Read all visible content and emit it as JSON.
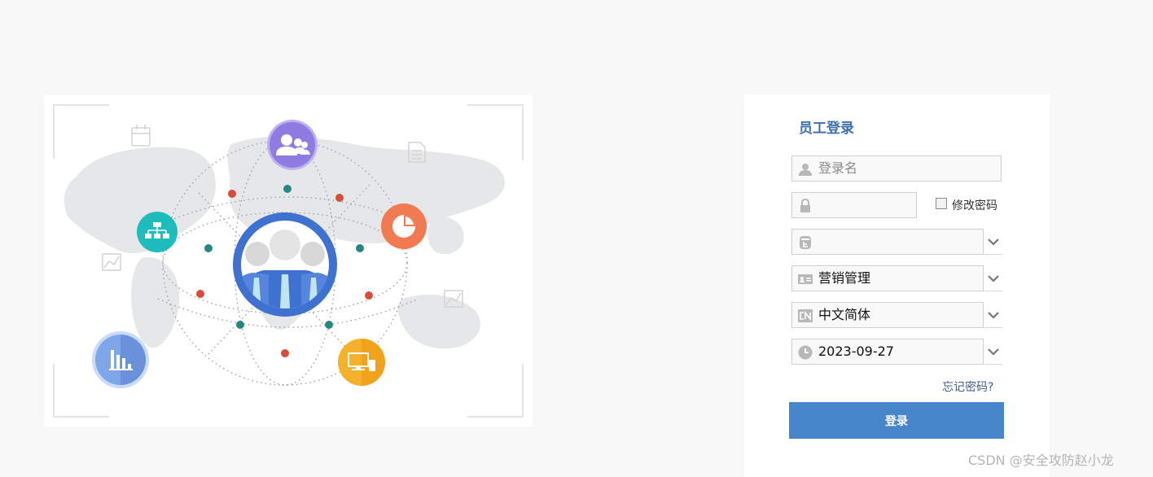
{
  "login": {
    "title": "员工登录",
    "username_placeholder": "登录名",
    "password_value": "",
    "change_password_label": "修改密码",
    "account_set_value": "",
    "module_value": "营销管理",
    "language_value": "中文简体",
    "date_value": "2023-09-27",
    "forgot_password": "忘记密码?",
    "submit_label": "登录"
  },
  "watermark": "CSDN @安全攻防赵小龙",
  "icons": {
    "illustration": [
      "people-icon",
      "sitemap-icon",
      "pie-chart-icon",
      "bar-chart-icon",
      "devices-icon",
      "user-group-icon",
      "calendar-icon",
      "document-icon",
      "line-chart-icon"
    ],
    "form": [
      "user-icon",
      "lock-icon",
      "database-icon",
      "id-card-icon",
      "cn-language-icon",
      "clock-icon",
      "chevron-down-icon",
      "checkbox"
    ]
  },
  "colors": {
    "accent": "#4886cc",
    "title": "#3e6fae",
    "center_circle": "#3f72d0",
    "purple": "#8f7be2",
    "teal": "#1ebcbc",
    "orange": "#f27a50",
    "yellow": "#f4b12c",
    "blue_light": "#7ea6e8"
  }
}
